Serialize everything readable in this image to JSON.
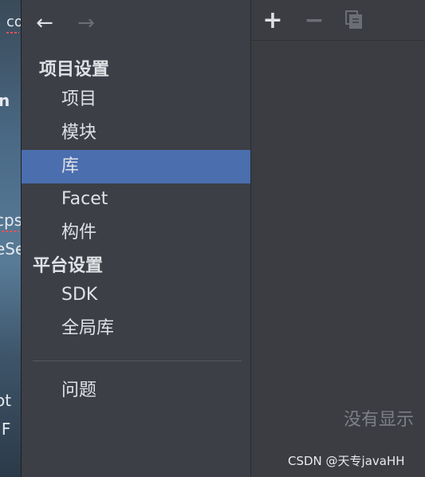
{
  "background_fragments": [
    "co",
    "n",
    "cps",
    "eSe",
    "ot",
    "IF"
  ],
  "nav": {
    "back_icon": "←",
    "forward_icon": "→"
  },
  "sidebar": {
    "project_settings": {
      "header": "项目设置",
      "items": [
        {
          "label": "项目",
          "selected": false
        },
        {
          "label": "模块",
          "selected": false
        },
        {
          "label": "库",
          "selected": true
        },
        {
          "label": "Facet",
          "selected": false
        },
        {
          "label": "构件",
          "selected": false
        }
      ]
    },
    "platform_settings": {
      "header": "平台设置",
      "items": [
        {
          "label": "SDK",
          "selected": false
        },
        {
          "label": "全局库",
          "selected": false
        }
      ]
    },
    "problems": {
      "label": "问题"
    }
  },
  "toolbar": {
    "add_icon": "+",
    "remove_icon": "−",
    "copy_icon": "copy-icon"
  },
  "right_panel": {
    "empty_text": "没有显示"
  },
  "watermark": "CSDN @天专javaHH",
  "colors": {
    "sidebar_bg": "#3c3f46",
    "selection": "#4b6eaf",
    "text": "#dfe1e5",
    "muted": "#6b6e75"
  }
}
